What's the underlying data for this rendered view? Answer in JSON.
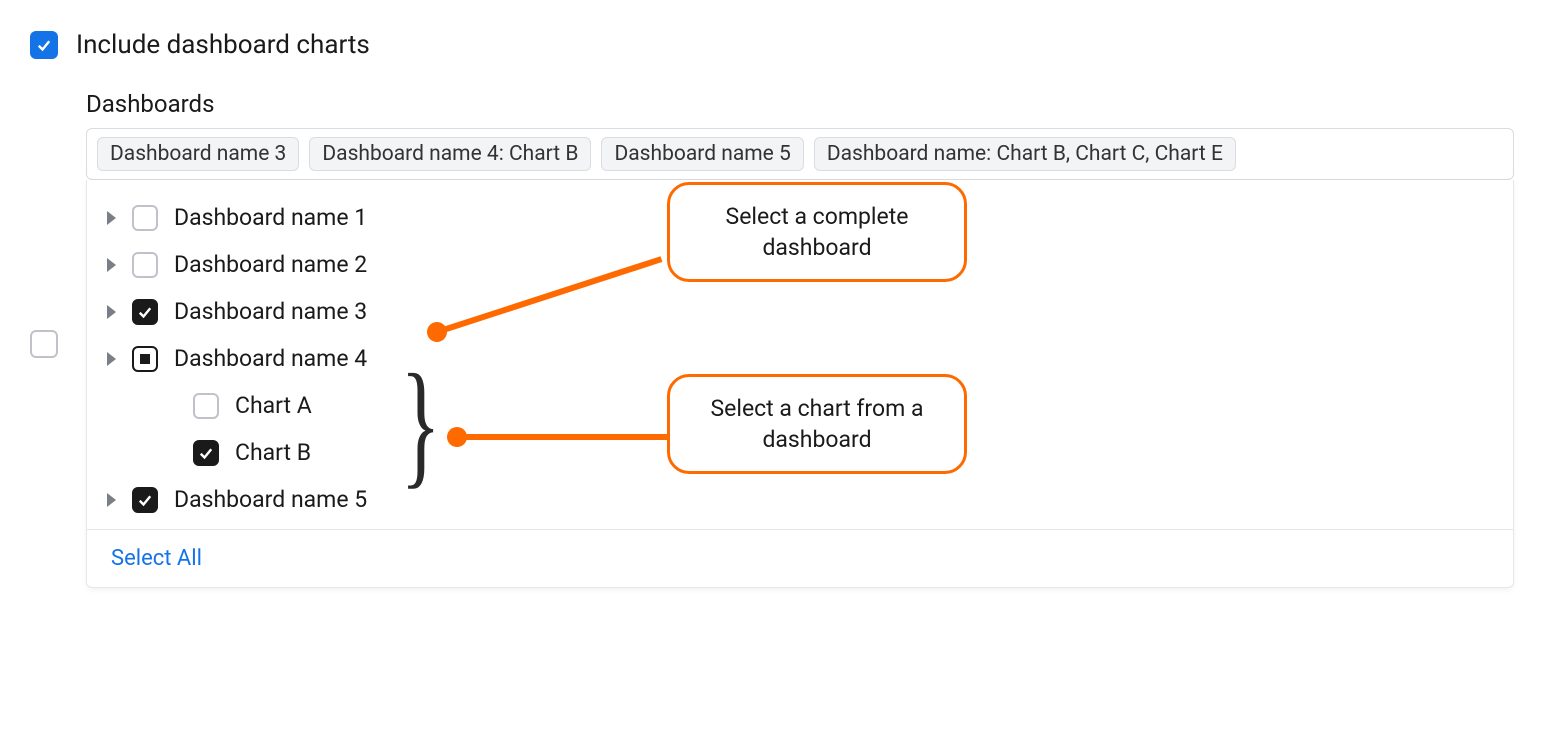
{
  "include_dashboard_charts": {
    "label": "Include dashboard charts",
    "checked": true
  },
  "dashboards": {
    "label": "Dashboards",
    "tags": [
      "Dashboard name 3",
      "Dashboard name 4: Chart B",
      "Dashboard name 5",
      "Dashboard name: Chart B, Chart C, Chart E"
    ],
    "items": [
      {
        "label": "Dashboard name 1",
        "state": "unchecked",
        "expandable": true
      },
      {
        "label": "Dashboard name 2",
        "state": "unchecked",
        "expandable": true
      },
      {
        "label": "Dashboard name 3",
        "state": "checked",
        "expandable": true
      },
      {
        "label": "Dashboard name 4",
        "state": "indeterminate",
        "expandable": true,
        "children": [
          {
            "label": "Chart A",
            "state": "unchecked"
          },
          {
            "label": "Chart B",
            "state": "checked"
          }
        ]
      },
      {
        "label": "Dashboard name 5",
        "state": "checked",
        "expandable": true
      }
    ],
    "select_all_label": "Select All"
  },
  "left_checkbox": {
    "state": "unchecked"
  },
  "annotations": {
    "complete": "Select a complete dashboard",
    "chart": "Select a chart from a dashboard"
  },
  "colors": {
    "primary": "#1473e6",
    "accent": "#ff6a00"
  }
}
